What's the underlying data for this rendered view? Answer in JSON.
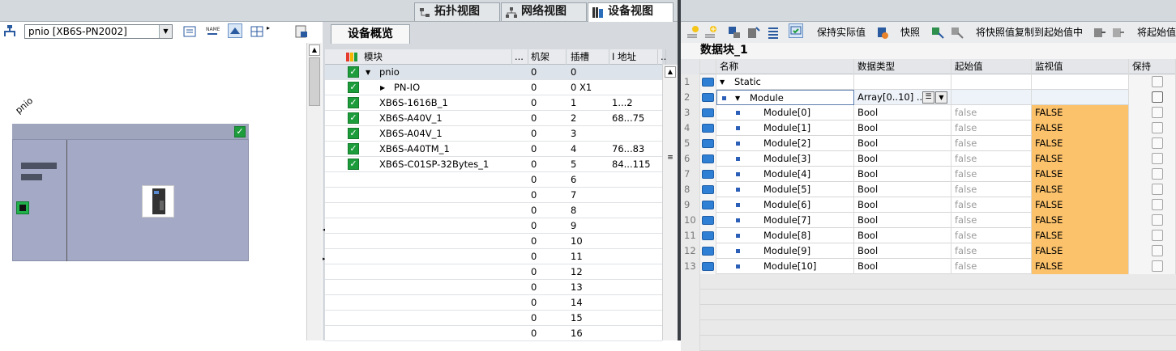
{
  "view_tabs": {
    "topology": "拓扑视图",
    "network": "网络视图",
    "device": "设备视图"
  },
  "device_selector": {
    "value": "pnio [XB6S-PN2002]"
  },
  "canvas": {
    "station_label": "pnio"
  },
  "overview": {
    "tab_label": "设备概览",
    "headers": {
      "module": "模块",
      "dots": "...",
      "rack": "机架",
      "slot": "插槽",
      "address": "I 地址",
      "more": "..."
    },
    "rows": [
      {
        "module": "pnio",
        "rack": "0",
        "slot": "0",
        "address": "",
        "check": true,
        "expand": "down",
        "indent": 0
      },
      {
        "module": "PN-IO",
        "rack": "0",
        "slot": "0 X1",
        "address": "",
        "check": true,
        "expand": "right",
        "indent": 1
      },
      {
        "module": "XB6S-1616B_1",
        "rack": "0",
        "slot": "1",
        "address": "1...2",
        "check": true,
        "indent": 0
      },
      {
        "module": "XB6S-A40V_1",
        "rack": "0",
        "slot": "2",
        "address": "68...75",
        "check": true,
        "indent": 0
      },
      {
        "module": "XB6S-A04V_1",
        "rack": "0",
        "slot": "3",
        "address": "",
        "check": true,
        "indent": 0
      },
      {
        "module": "XB6S-A40TM_1",
        "rack": "0",
        "slot": "4",
        "address": "76...83",
        "check": true,
        "indent": 0
      },
      {
        "module": "XB6S-C01SP-32Bytes_1",
        "rack": "0",
        "slot": "5",
        "address": "84...115",
        "check": true,
        "indent": 0
      },
      {
        "module": "",
        "rack": "0",
        "slot": "6",
        "address": ""
      },
      {
        "module": "",
        "rack": "0",
        "slot": "7",
        "address": ""
      },
      {
        "module": "",
        "rack": "0",
        "slot": "8",
        "address": ""
      },
      {
        "module": "",
        "rack": "0",
        "slot": "9",
        "address": ""
      },
      {
        "module": "",
        "rack": "0",
        "slot": "10",
        "address": ""
      },
      {
        "module": "",
        "rack": "0",
        "slot": "11",
        "address": ""
      },
      {
        "module": "",
        "rack": "0",
        "slot": "12",
        "address": ""
      },
      {
        "module": "",
        "rack": "0",
        "slot": "13",
        "address": ""
      },
      {
        "module": "",
        "rack": "0",
        "slot": "14",
        "address": ""
      },
      {
        "module": "",
        "rack": "0",
        "slot": "15",
        "address": ""
      },
      {
        "module": "",
        "rack": "0",
        "slot": "16",
        "address": ""
      }
    ]
  },
  "db_toolbar": {
    "keep_actual": "保持实际值",
    "snapshot": "快照",
    "copy_snapshot": "将快照值复制到起始值中",
    "to_start": "将起始值"
  },
  "db": {
    "title": "数据块_1",
    "headers": {
      "name": "名称",
      "type": "数据类型",
      "start": "起始值",
      "monitor": "监视值",
      "retain": "保持"
    },
    "rows": [
      {
        "num": "1",
        "name": "Static",
        "type": "",
        "start": "",
        "monitor": "",
        "level": 0
      },
      {
        "num": "2",
        "name": "Module",
        "type": "Array[0..10] ...",
        "start": "",
        "monitor": "",
        "level": 1
      },
      {
        "num": "3",
        "name": "Module[0]",
        "type": "Bool",
        "start": "false",
        "monitor": "FALSE",
        "level": 2
      },
      {
        "num": "4",
        "name": "Module[1]",
        "type": "Bool",
        "start": "false",
        "monitor": "FALSE",
        "level": 2
      },
      {
        "num": "5",
        "name": "Module[2]",
        "type": "Bool",
        "start": "false",
        "monitor": "FALSE",
        "level": 2
      },
      {
        "num": "6",
        "name": "Module[3]",
        "type": "Bool",
        "start": "false",
        "monitor": "FALSE",
        "level": 2
      },
      {
        "num": "7",
        "name": "Module[4]",
        "type": "Bool",
        "start": "false",
        "monitor": "FALSE",
        "level": 2
      },
      {
        "num": "8",
        "name": "Module[5]",
        "type": "Bool",
        "start": "false",
        "monitor": "FALSE",
        "level": 2
      },
      {
        "num": "9",
        "name": "Module[6]",
        "type": "Bool",
        "start": "false",
        "monitor": "FALSE",
        "level": 2
      },
      {
        "num": "10",
        "name": "Module[7]",
        "type": "Bool",
        "start": "false",
        "monitor": "FALSE",
        "level": 2
      },
      {
        "num": "11",
        "name": "Module[8]",
        "type": "Bool",
        "start": "false",
        "monitor": "FALSE",
        "level": 2
      },
      {
        "num": "12",
        "name": "Module[9]",
        "type": "Bool",
        "start": "false",
        "monitor": "FALSE",
        "level": 2
      },
      {
        "num": "13",
        "name": "Module[10]",
        "type": "Bool",
        "start": "false",
        "monitor": "FALSE",
        "level": 2
      }
    ]
  },
  "colors": {
    "monitor_bg": "#fcc26b",
    "check_green": "#1d9c3c",
    "rack_fill": "#a4aac6"
  }
}
